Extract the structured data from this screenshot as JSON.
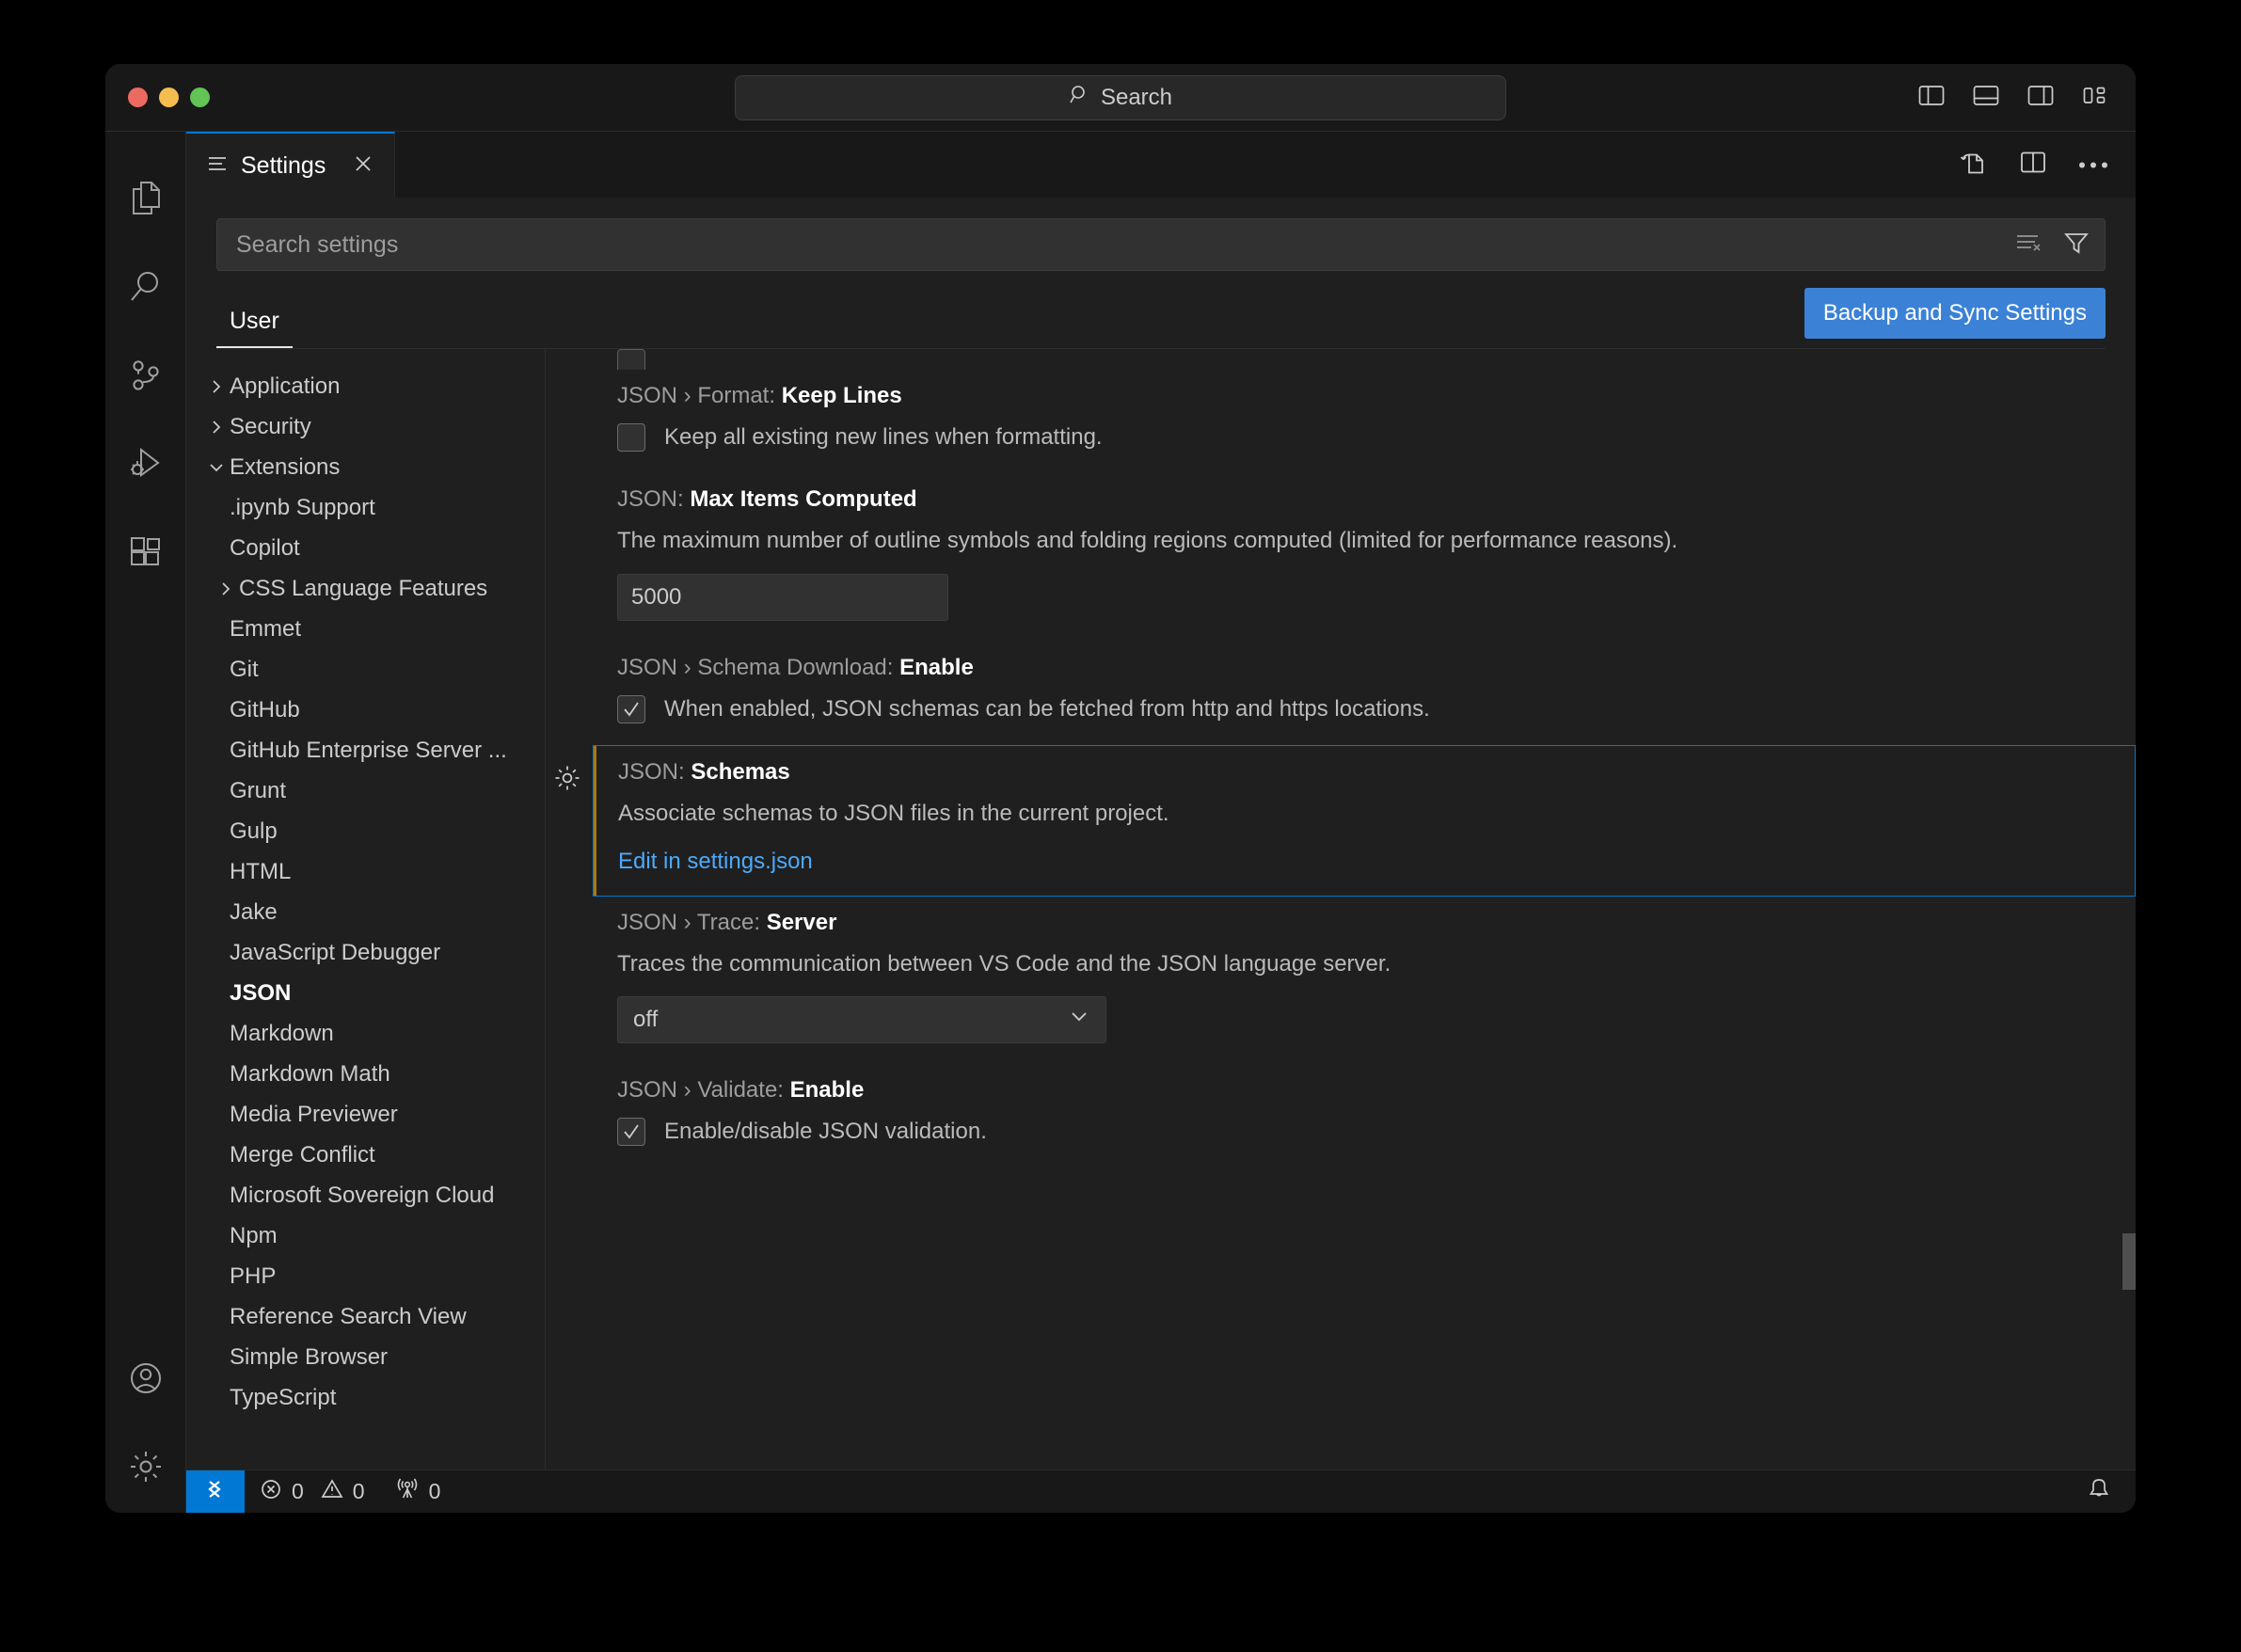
{
  "window": {
    "traffic_lights": [
      "close",
      "minimize",
      "maximize"
    ]
  },
  "titlebar": {
    "back_icon": "arrow-left-icon",
    "forward_icon": "arrow-right-icon",
    "command_center_label": "Search",
    "command_center_icon": "search-icon",
    "layout_icons": [
      "toggle-primary-sidebar-icon",
      "toggle-panel-icon",
      "toggle-secondary-sidebar-icon",
      "customize-layout-icon"
    ]
  },
  "activitybar": {
    "items": [
      {
        "name": "explorer",
        "icon": "files-icon"
      },
      {
        "name": "search",
        "icon": "search-icon"
      },
      {
        "name": "source-control",
        "icon": "source-control-icon"
      },
      {
        "name": "run-and-debug",
        "icon": "run-and-debug-icon"
      },
      {
        "name": "extensions",
        "icon": "extensions-icon"
      }
    ],
    "bottom_items": [
      {
        "name": "accounts",
        "icon": "account-icon"
      },
      {
        "name": "manage",
        "icon": "gear-icon"
      }
    ]
  },
  "tabbar": {
    "tab_label": "Settings",
    "tab_icon": "settings-editor-icon",
    "close_icon": "close-icon",
    "actions": [
      "open-settings-json-icon",
      "split-editor-icon",
      "more-actions-icon"
    ]
  },
  "settings_editor": {
    "search_placeholder": "Search settings",
    "search_icons": [
      "clear-filters-icon",
      "filter-icon"
    ],
    "scope_tabs": [
      {
        "label": "User",
        "selected": true
      }
    ],
    "backup_button_label": "Backup and Sync Settings",
    "accent_color": "#3b82d6"
  },
  "toc": {
    "items": [
      {
        "label": "Application",
        "level": 0,
        "twisty": "chevron-right",
        "selected": false
      },
      {
        "label": "Security",
        "level": 0,
        "twisty": "chevron-right",
        "selected": false
      },
      {
        "label": "Extensions",
        "level": 0,
        "twisty": "chevron-down",
        "selected": false
      },
      {
        "label": ".ipynb Support",
        "level": 1,
        "twisty": "none",
        "selected": false
      },
      {
        "label": "Copilot",
        "level": 1,
        "twisty": "none",
        "selected": false
      },
      {
        "label": "CSS Language Features",
        "level": 1,
        "twisty": "chevron-right",
        "selected": false
      },
      {
        "label": "Emmet",
        "level": 1,
        "twisty": "none",
        "selected": false
      },
      {
        "label": "Git",
        "level": 1,
        "twisty": "none",
        "selected": false
      },
      {
        "label": "GitHub",
        "level": 1,
        "twisty": "none",
        "selected": false
      },
      {
        "label": "GitHub Enterprise Server ...",
        "level": 1,
        "twisty": "none",
        "selected": false
      },
      {
        "label": "Grunt",
        "level": 1,
        "twisty": "none",
        "selected": false
      },
      {
        "label": "Gulp",
        "level": 1,
        "twisty": "none",
        "selected": false
      },
      {
        "label": "HTML",
        "level": 1,
        "twisty": "none",
        "selected": false
      },
      {
        "label": "Jake",
        "level": 1,
        "twisty": "none",
        "selected": false
      },
      {
        "label": "JavaScript Debugger",
        "level": 1,
        "twisty": "none",
        "selected": false
      },
      {
        "label": "JSON",
        "level": 1,
        "twisty": "none",
        "selected": true
      },
      {
        "label": "Markdown",
        "level": 1,
        "twisty": "none",
        "selected": false
      },
      {
        "label": "Markdown Math",
        "level": 1,
        "twisty": "none",
        "selected": false
      },
      {
        "label": "Media Previewer",
        "level": 1,
        "twisty": "none",
        "selected": false
      },
      {
        "label": "Merge Conflict",
        "level": 1,
        "twisty": "none",
        "selected": false
      },
      {
        "label": "Microsoft Sovereign Cloud",
        "level": 1,
        "twisty": "none",
        "selected": false
      },
      {
        "label": "Npm",
        "level": 1,
        "twisty": "none",
        "selected": false
      },
      {
        "label": "PHP",
        "level": 1,
        "twisty": "none",
        "selected": false
      },
      {
        "label": "Reference Search View",
        "level": 1,
        "twisty": "none",
        "selected": false
      },
      {
        "label": "Simple Browser",
        "level": 1,
        "twisty": "none",
        "selected": false
      },
      {
        "label": "TypeScript",
        "level": 1,
        "twisty": "none",
        "selected": false
      }
    ]
  },
  "settings": {
    "keep_lines": {
      "prefix": "JSON › Format: ",
      "name": "Keep Lines",
      "checkbox_label": "Keep all existing new lines when formatting.",
      "checked": false
    },
    "max_items": {
      "prefix": "JSON: ",
      "name": "Max Items Computed",
      "description": "The maximum number of outline symbols and folding regions computed (limited for performance reasons).",
      "value": "5000"
    },
    "schema_download": {
      "prefix": "JSON › Schema Download: ",
      "name": "Enable",
      "checkbox_label": "When enabled, JSON schemas can be fetched from http and https locations.",
      "checked": true
    },
    "schemas": {
      "prefix": "JSON: ",
      "name": "Schemas",
      "description": "Associate schemas to JSON files in the current project.",
      "link_label": "Edit in settings.json",
      "focused": true,
      "modified": true,
      "gear_icon": "gear-icon",
      "focus_border_color": "#0078d4",
      "modified_marker_color": "#a07c20",
      "link_color": "#4daafc"
    },
    "trace_server": {
      "prefix": "JSON › Trace: ",
      "name": "Server",
      "description": "Traces the communication between VS Code and the JSON language server.",
      "selected_option": "off",
      "dropdown_icon": "chevron-down-icon"
    },
    "validate": {
      "prefix": "JSON › Validate: ",
      "name": "Enable",
      "checkbox_label": "Enable/disable JSON validation.",
      "checked": true
    }
  },
  "statusbar": {
    "remote_icon": "remote-host-icon",
    "error_icon": "error-icon",
    "error_count": "0",
    "warning_icon": "warning-icon",
    "warning_count": "0",
    "ports_icon": "radio-tower-icon",
    "ports_count": "0",
    "bell_icon": "bell-icon"
  }
}
